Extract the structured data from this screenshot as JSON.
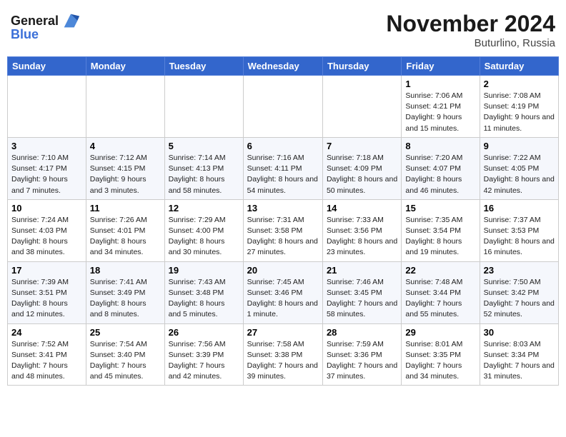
{
  "header": {
    "logo_line1": "General",
    "logo_line2": "Blue",
    "month_title": "November 2024",
    "location": "Buturlino, Russia"
  },
  "weekdays": [
    "Sunday",
    "Monday",
    "Tuesday",
    "Wednesday",
    "Thursday",
    "Friday",
    "Saturday"
  ],
  "weeks": [
    [
      {
        "day": "",
        "info": ""
      },
      {
        "day": "",
        "info": ""
      },
      {
        "day": "",
        "info": ""
      },
      {
        "day": "",
        "info": ""
      },
      {
        "day": "",
        "info": ""
      },
      {
        "day": "1",
        "info": "Sunrise: 7:06 AM\nSunset: 4:21 PM\nDaylight: 9 hours and 15 minutes."
      },
      {
        "day": "2",
        "info": "Sunrise: 7:08 AM\nSunset: 4:19 PM\nDaylight: 9 hours and 11 minutes."
      }
    ],
    [
      {
        "day": "3",
        "info": "Sunrise: 7:10 AM\nSunset: 4:17 PM\nDaylight: 9 hours and 7 minutes."
      },
      {
        "day": "4",
        "info": "Sunrise: 7:12 AM\nSunset: 4:15 PM\nDaylight: 9 hours and 3 minutes."
      },
      {
        "day": "5",
        "info": "Sunrise: 7:14 AM\nSunset: 4:13 PM\nDaylight: 8 hours and 58 minutes."
      },
      {
        "day": "6",
        "info": "Sunrise: 7:16 AM\nSunset: 4:11 PM\nDaylight: 8 hours and 54 minutes."
      },
      {
        "day": "7",
        "info": "Sunrise: 7:18 AM\nSunset: 4:09 PM\nDaylight: 8 hours and 50 minutes."
      },
      {
        "day": "8",
        "info": "Sunrise: 7:20 AM\nSunset: 4:07 PM\nDaylight: 8 hours and 46 minutes."
      },
      {
        "day": "9",
        "info": "Sunrise: 7:22 AM\nSunset: 4:05 PM\nDaylight: 8 hours and 42 minutes."
      }
    ],
    [
      {
        "day": "10",
        "info": "Sunrise: 7:24 AM\nSunset: 4:03 PM\nDaylight: 8 hours and 38 minutes."
      },
      {
        "day": "11",
        "info": "Sunrise: 7:26 AM\nSunset: 4:01 PM\nDaylight: 8 hours and 34 minutes."
      },
      {
        "day": "12",
        "info": "Sunrise: 7:29 AM\nSunset: 4:00 PM\nDaylight: 8 hours and 30 minutes."
      },
      {
        "day": "13",
        "info": "Sunrise: 7:31 AM\nSunset: 3:58 PM\nDaylight: 8 hours and 27 minutes."
      },
      {
        "day": "14",
        "info": "Sunrise: 7:33 AM\nSunset: 3:56 PM\nDaylight: 8 hours and 23 minutes."
      },
      {
        "day": "15",
        "info": "Sunrise: 7:35 AM\nSunset: 3:54 PM\nDaylight: 8 hours and 19 minutes."
      },
      {
        "day": "16",
        "info": "Sunrise: 7:37 AM\nSunset: 3:53 PM\nDaylight: 8 hours and 16 minutes."
      }
    ],
    [
      {
        "day": "17",
        "info": "Sunrise: 7:39 AM\nSunset: 3:51 PM\nDaylight: 8 hours and 12 minutes."
      },
      {
        "day": "18",
        "info": "Sunrise: 7:41 AM\nSunset: 3:49 PM\nDaylight: 8 hours and 8 minutes."
      },
      {
        "day": "19",
        "info": "Sunrise: 7:43 AM\nSunset: 3:48 PM\nDaylight: 8 hours and 5 minutes."
      },
      {
        "day": "20",
        "info": "Sunrise: 7:45 AM\nSunset: 3:46 PM\nDaylight: 8 hours and 1 minute."
      },
      {
        "day": "21",
        "info": "Sunrise: 7:46 AM\nSunset: 3:45 PM\nDaylight: 7 hours and 58 minutes."
      },
      {
        "day": "22",
        "info": "Sunrise: 7:48 AM\nSunset: 3:44 PM\nDaylight: 7 hours and 55 minutes."
      },
      {
        "day": "23",
        "info": "Sunrise: 7:50 AM\nSunset: 3:42 PM\nDaylight: 7 hours and 52 minutes."
      }
    ],
    [
      {
        "day": "24",
        "info": "Sunrise: 7:52 AM\nSunset: 3:41 PM\nDaylight: 7 hours and 48 minutes."
      },
      {
        "day": "25",
        "info": "Sunrise: 7:54 AM\nSunset: 3:40 PM\nDaylight: 7 hours and 45 minutes."
      },
      {
        "day": "26",
        "info": "Sunrise: 7:56 AM\nSunset: 3:39 PM\nDaylight: 7 hours and 42 minutes."
      },
      {
        "day": "27",
        "info": "Sunrise: 7:58 AM\nSunset: 3:38 PM\nDaylight: 7 hours and 39 minutes."
      },
      {
        "day": "28",
        "info": "Sunrise: 7:59 AM\nSunset: 3:36 PM\nDaylight: 7 hours and 37 minutes."
      },
      {
        "day": "29",
        "info": "Sunrise: 8:01 AM\nSunset: 3:35 PM\nDaylight: 7 hours and 34 minutes."
      },
      {
        "day": "30",
        "info": "Sunrise: 8:03 AM\nSunset: 3:34 PM\nDaylight: 7 hours and 31 minutes."
      }
    ]
  ]
}
